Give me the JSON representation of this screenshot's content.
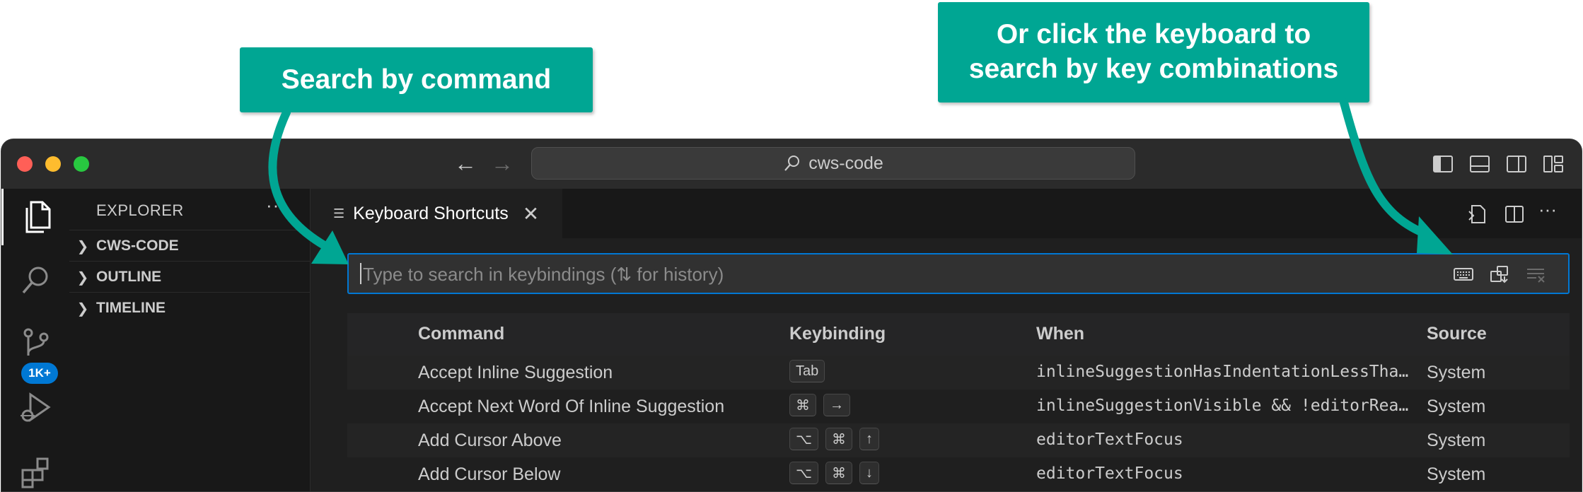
{
  "callouts": {
    "search_command": "Search by command",
    "keyboard_line1": "Or click the keyboard to",
    "keyboard_line2": "search by key combinations"
  },
  "titlebar": {
    "command_center": "cws-code",
    "back_icon": "arrow-left-icon",
    "forward_icon": "arrow-right-icon",
    "layout_icons": [
      "toggle-primary-sidebar-icon",
      "toggle-panel-icon",
      "toggle-secondary-sidebar-icon",
      "customize-layout-icon"
    ]
  },
  "activity_bar": {
    "items": [
      "explorer-icon",
      "search-icon",
      "source-control-icon",
      "run-debug-icon",
      "extensions-icon"
    ],
    "source_control_badge": "1K+"
  },
  "sidebar": {
    "title": "EXPLORER",
    "more": "···",
    "sections": [
      {
        "label": "CWS-CODE"
      },
      {
        "label": "OUTLINE"
      },
      {
        "label": "TIMELINE"
      }
    ]
  },
  "editor": {
    "tab_label": "Keyboard Shortcuts",
    "tab_close": "✕",
    "more": "···",
    "search_placeholder": "Type to search in keybindings (⇅ for history)",
    "columns": {
      "command": "Command",
      "keybinding": "Keybinding",
      "when": "When",
      "source": "Source"
    },
    "rows": [
      {
        "command": "Accept Inline Suggestion",
        "keys": [
          "Tab"
        ],
        "when": "inlineSuggestionHasIndentationLessThanTabSize",
        "source": "System"
      },
      {
        "command": "Accept Next Word Of Inline Suggestion",
        "keys": [
          "⌘",
          "→"
        ],
        "when": "inlineSuggestionVisible && !editorReadonly",
        "source": "System"
      },
      {
        "command": "Add Cursor Above",
        "keys": [
          "⌥",
          "⌘",
          "↑"
        ],
        "when": "editorTextFocus",
        "source": "System"
      },
      {
        "command": "Add Cursor Below",
        "keys": [
          "⌥",
          "⌘",
          "↓"
        ],
        "when": "editorTextFocus",
        "source": "System"
      }
    ]
  },
  "colors": {
    "callout": "#00a693",
    "accent_blue": "#0078d4",
    "traffic_red": "#ff5f57",
    "traffic_yellow": "#febc2e",
    "traffic_green": "#28c840"
  }
}
